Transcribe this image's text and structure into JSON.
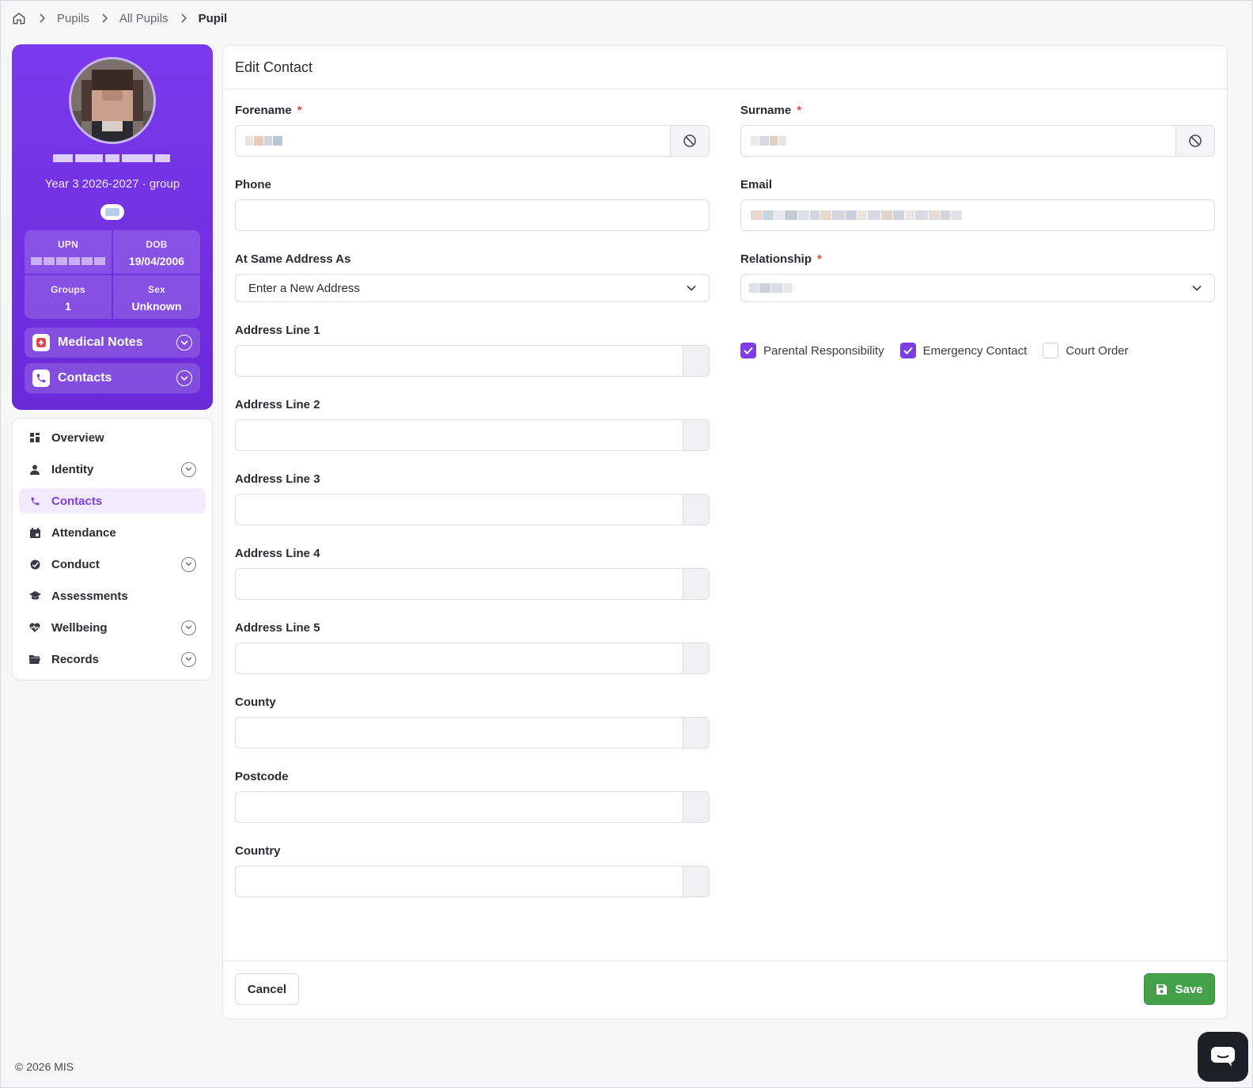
{
  "breadcrumb": {
    "items": [
      "Pupils",
      "All Pupils"
    ],
    "current": "Pupil"
  },
  "profile": {
    "group_line": "Year 3 2026-2027 · group",
    "stats": {
      "upn_label": "UPN",
      "dob_label": "DOB",
      "dob_value": "19/04/2006",
      "groups_label": "Groups",
      "groups_value": "1",
      "sex_label": "Sex",
      "sex_value": "Unknown"
    },
    "medical_notes": "Medical Notes",
    "contacts": "Contacts"
  },
  "nav": {
    "overview": "Overview",
    "identity": "Identity",
    "contacts": "Contacts",
    "attendance": "Attendance",
    "conduct": "Conduct",
    "assessments": "Assessments",
    "wellbeing": "Wellbeing",
    "records": "Records"
  },
  "form": {
    "title": "Edit Contact",
    "forename_label": "Forename",
    "surname_label": "Surname",
    "phone_label": "Phone",
    "email_label": "Email",
    "same_address_label": "At Same Address As",
    "same_address_value": "Enter a New Address",
    "relationship_label": "Relationship",
    "address1_label": "Address Line 1",
    "address2_label": "Address Line 2",
    "address3_label": "Address Line 3",
    "address4_label": "Address Line 4",
    "address5_label": "Address Line 5",
    "county_label": "County",
    "postcode_label": "Postcode",
    "country_label": "Country",
    "required_mark": "*",
    "checkboxes": {
      "parental": {
        "label": "Parental Responsibility",
        "checked": true
      },
      "emergency": {
        "label": "Emergency Contact",
        "checked": true
      },
      "court": {
        "label": "Court Order",
        "checked": false
      }
    }
  },
  "actions": {
    "cancel": "Cancel",
    "save": "Save"
  },
  "footer": "© 2026 MIS",
  "colors": {
    "accent": "#7b3fe4",
    "save": "#45a04a",
    "required": "#e04848"
  }
}
